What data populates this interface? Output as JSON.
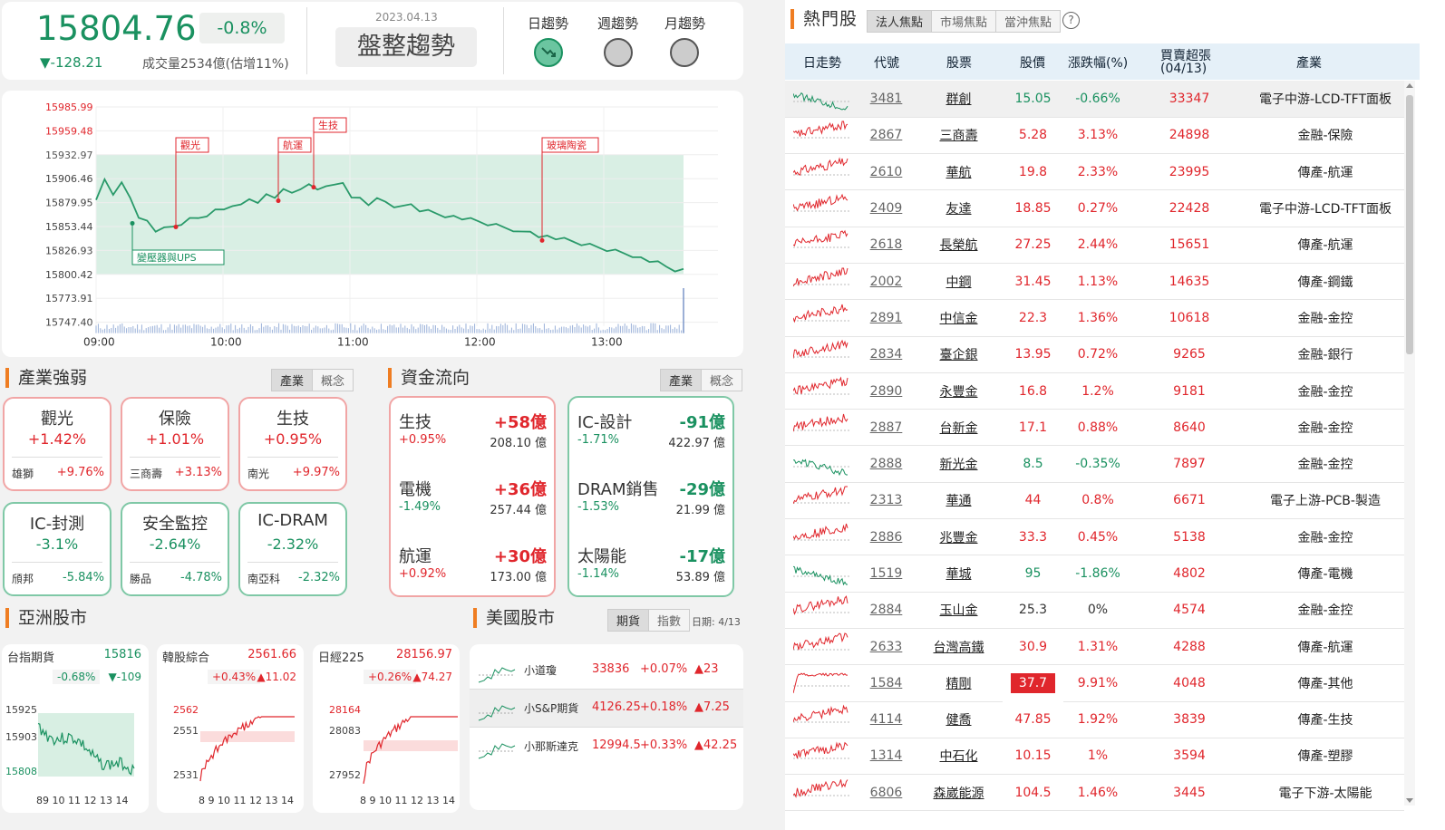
{
  "index": {
    "value": "15804.76",
    "pct": "-0.8%",
    "change": "▼-128.21",
    "volume": "成交量2534億(估增11%)",
    "date": "2023.04.13",
    "trend": "盤整趨勢"
  },
  "trends": {
    "day": "日趨勢",
    "week": "週趨勢",
    "month": "月趨勢"
  },
  "intraday": {
    "y_ticks": [
      "15985.99",
      "15959.48",
      "15932.97",
      "15906.46",
      "15879.95",
      "15853.44",
      "15826.93",
      "15800.42",
      "15773.91",
      "15747.40"
    ],
    "x_ticks": [
      "09:00",
      "10:00",
      "11:00",
      "12:00",
      "13:00"
    ],
    "annotations": [
      "觀光",
      "航運",
      "生技",
      "玻璃陶瓷",
      "變壓器與UPS"
    ],
    "series": [
      15880,
      15905,
      15890,
      15900,
      15885,
      15865,
      15858,
      15848,
      15855,
      15852,
      15856,
      15860,
      15862,
      15866,
      15870,
      15872,
      15878,
      15876,
      15884,
      15882,
      15888,
      15886,
      15892,
      15890,
      15896,
      15898,
      15894,
      15900,
      15898,
      15902,
      15888,
      15884,
      15878,
      15882,
      15880,
      15876,
      15874,
      15878,
      15872,
      15870,
      15868,
      15866,
      15864,
      15862,
      15860,
      15858,
      15856,
      15854,
      15852,
      15850,
      15846,
      15848,
      15844,
      15842,
      15840,
      15838,
      15836,
      15834,
      15832,
      15830,
      15828,
      15826,
      15824,
      15822,
      15818,
      15815,
      15812,
      15808,
      15805,
      15804
    ]
  },
  "industry": {
    "title": "產業強弱",
    "tabs": [
      "產業",
      "概念"
    ],
    "items": [
      {
        "name": "觀光",
        "pct": "+1.42%",
        "stock": "雄獅",
        "spct": "+9.76%",
        "c": "up"
      },
      {
        "name": "保險",
        "pct": "+1.01%",
        "stock": "三商壽",
        "spct": "+3.13%",
        "c": "up"
      },
      {
        "name": "生技",
        "pct": "+0.95%",
        "stock": "南光",
        "spct": "+9.97%",
        "c": "up"
      },
      {
        "name": "IC-封測",
        "pct": "-3.1%",
        "stock": "頎邦",
        "spct": "-5.84%",
        "c": "dn"
      },
      {
        "name": "安全監控",
        "pct": "-2.64%",
        "stock": "勝品",
        "spct": "-4.78%",
        "c": "dn"
      },
      {
        "name": "IC-DRAM",
        "pct": "-2.32%",
        "stock": "南亞科",
        "spct": "-2.32%",
        "c": "dn"
      }
    ]
  },
  "flow": {
    "title": "資金流向",
    "tabs": [
      "產業",
      "概念"
    ],
    "up": [
      {
        "name": "生技",
        "val": "+58億",
        "pct": "+0.95%",
        "amt": "208.10 億"
      },
      {
        "name": "電機",
        "val": "+36億",
        "pct": "-1.49%",
        "amt": "257.44 億"
      },
      {
        "name": "航運",
        "val": "+30億",
        "pct": "+0.92%",
        "amt": "173.00 億"
      }
    ],
    "dn": [
      {
        "name": "IC-設計",
        "val": "-91億",
        "pct": "-1.71%",
        "amt": "422.97 億"
      },
      {
        "name": "DRAM銷售",
        "val": "-29億",
        "pct": "-1.53%",
        "amt": "21.99 億"
      },
      {
        "name": "太陽能",
        "val": "-17億",
        "pct": "-1.14%",
        "amt": "53.89 億"
      }
    ]
  },
  "asia": {
    "title": "亞洲股市",
    "markets": [
      {
        "name": "台指期貨",
        "value": "15816",
        "pct": "-0.68%",
        "chg": "▼-109",
        "c": "dn",
        "ticks": [
          "15925",
          "15903",
          "15808"
        ],
        "xt": "89 10 11 12 13 14"
      },
      {
        "name": "韓股綜合",
        "value": "2561.66",
        "pct": "+0.43%",
        "chg": "▲11.02",
        "c": "up",
        "ticks": [
          "2562",
          "2551",
          "2531"
        ],
        "xt": "8 9 10 11 12 13 14"
      },
      {
        "name": "日經225",
        "value": "28156.97",
        "pct": "+0.26%",
        "chg": "▲74.27",
        "c": "up",
        "ticks": [
          "28164",
          "28083",
          "27952"
        ],
        "xt": "8 9 10 11 12 13 14"
      }
    ]
  },
  "us": {
    "title": "美國股市",
    "tabs": [
      "期貨",
      "指數"
    ],
    "date": "日期: 4/13",
    "rows": [
      {
        "name": "小道瓊",
        "value": "33836",
        "pct": "+0.07%",
        "chg": "▲23"
      },
      {
        "name": "小S&P期貨",
        "value": "4126.25",
        "pct": "+0.18%",
        "chg": "▲7.25"
      },
      {
        "name": "小那斯達克",
        "value": "12994.5",
        "pct": "+0.33%",
        "chg": "▲42.25"
      }
    ]
  },
  "hot": {
    "title": "熱門股",
    "tabs": [
      "法人焦點",
      "市場焦點",
      "當沖焦點"
    ],
    "headers": [
      "日走勢",
      "代號",
      "股票",
      "股價",
      "漲跌幅(%)",
      "買賣超張",
      "(04/13)",
      "產業"
    ],
    "rows": [
      {
        "code": "3481",
        "name": "群創",
        "price": "15.05",
        "pct": "-0.66%",
        "vol": "33347",
        "ind": "電子中游-LCD-TFT面板",
        "c": "dn"
      },
      {
        "code": "2867",
        "name": "三商壽",
        "price": "5.28",
        "pct": "3.13%",
        "vol": "24898",
        "ind": "金融-保險",
        "c": "up"
      },
      {
        "code": "2610",
        "name": "華航",
        "price": "19.8",
        "pct": "2.33%",
        "vol": "23995",
        "ind": "傳產-航運",
        "c": "up"
      },
      {
        "code": "2409",
        "name": "友達",
        "price": "18.85",
        "pct": "0.27%",
        "vol": "22428",
        "ind": "電子中游-LCD-TFT面板",
        "c": "up"
      },
      {
        "code": "2618",
        "name": "長榮航",
        "price": "27.25",
        "pct": "2.44%",
        "vol": "15651",
        "ind": "傳產-航運",
        "c": "up"
      },
      {
        "code": "2002",
        "name": "中鋼",
        "price": "31.45",
        "pct": "1.13%",
        "vol": "14635",
        "ind": "傳產-鋼鐵",
        "c": "up"
      },
      {
        "code": "2891",
        "name": "中信金",
        "price": "22.3",
        "pct": "1.36%",
        "vol": "10618",
        "ind": "金融-金控",
        "c": "up"
      },
      {
        "code": "2834",
        "name": "臺企銀",
        "price": "13.95",
        "pct": "0.72%",
        "vol": "9265",
        "ind": "金融-銀行",
        "c": "up"
      },
      {
        "code": "2890",
        "name": "永豐金",
        "price": "16.8",
        "pct": "1.2%",
        "vol": "9181",
        "ind": "金融-金控",
        "c": "up"
      },
      {
        "code": "2887",
        "name": "台新金",
        "price": "17.1",
        "pct": "0.88%",
        "vol": "8640",
        "ind": "金融-金控",
        "c": "up"
      },
      {
        "code": "2888",
        "name": "新光金",
        "price": "8.5",
        "pct": "-0.35%",
        "vol": "7897",
        "ind": "金融-金控",
        "c": "dn"
      },
      {
        "code": "2313",
        "name": "華通",
        "price": "44",
        "pct": "0.8%",
        "vol": "6671",
        "ind": "電子上游-PCB-製造",
        "c": "up"
      },
      {
        "code": "2886",
        "name": "兆豐金",
        "price": "33.3",
        "pct": "0.45%",
        "vol": "5138",
        "ind": "金融-金控",
        "c": "up"
      },
      {
        "code": "1519",
        "name": "華城",
        "price": "95",
        "pct": "-1.86%",
        "vol": "4802",
        "ind": "傳產-電機",
        "c": "dn"
      },
      {
        "code": "2884",
        "name": "玉山金",
        "price": "25.3",
        "pct": "0%",
        "vol": "4574",
        "ind": "金融-金控",
        "c": "flat"
      },
      {
        "code": "2633",
        "name": "台灣高鐵",
        "price": "30.9",
        "pct": "1.31%",
        "vol": "4288",
        "ind": "傳產-航運",
        "c": "up"
      },
      {
        "code": "1584",
        "name": "精剛",
        "price": "37.7",
        "pct": "9.91%",
        "vol": "4048",
        "ind": "傳產-其他",
        "c": "limit"
      },
      {
        "code": "4114",
        "name": "健喬",
        "price": "47.85",
        "pct": "1.92%",
        "vol": "3839",
        "ind": "傳產-生技",
        "c": "up"
      },
      {
        "code": "1314",
        "name": "中石化",
        "price": "10.15",
        "pct": "1%",
        "vol": "3594",
        "ind": "傳產-塑膠",
        "c": "up"
      },
      {
        "code": "6806",
        "name": "森崴能源",
        "price": "104.5",
        "pct": "1.46%",
        "vol": "3445",
        "ind": "電子下游-太陽能",
        "c": "up"
      }
    ]
  },
  "colors": {
    "up": "#e0262c",
    "down": "#1a9160",
    "accent": "#ef7d22"
  }
}
